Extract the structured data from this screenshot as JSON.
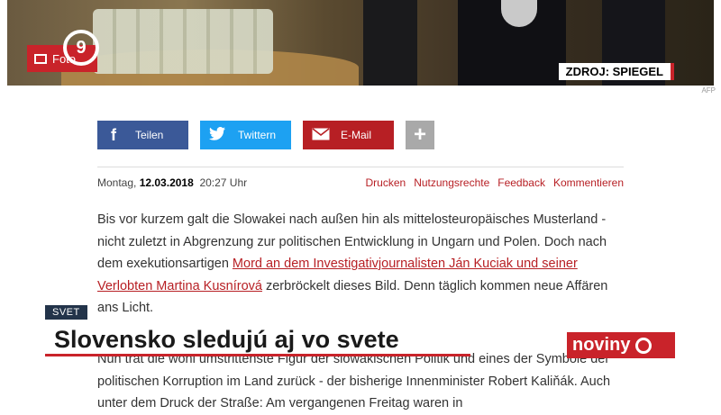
{
  "photo": {
    "badge_label": "Foto",
    "logo_text": "9",
    "source": "ZDROJ: SPIEGEL",
    "credit": "AFP"
  },
  "share": {
    "facebook": "Teilen",
    "twitter": "Twittern",
    "email": "E-Mail",
    "more": "+"
  },
  "meta": {
    "weekday": "Montag,",
    "date": "12.03.2018",
    "time": "20:27 Uhr",
    "links": [
      "Drucken",
      "Nutzungsrechte",
      "Feedback",
      "Kommentieren"
    ]
  },
  "article": {
    "p1_text_a": "Bis vor kurzem galt die Slowakei nach außen hin als mittelosteuropäisches Musterland - nicht zuletzt in Abgrenzung zur politischen Entwicklung in Ungarn und Polen. Doch nach dem exekutionsartigen ",
    "p1_link": "Mord an dem Investigativjournalisten Ján Kuciak und seiner Verlobten Martina Kusnírová",
    "p1_text_b": " zerbröckelt dieses Bild. Denn täglich kommen neue Affären ans Licht.",
    "p2_text_a": "Nun trat die wohl umstrittenste Figur der slowakischen Politik und eines der Symbole der politischen Korruption im Land zurück - der ",
    "p2_link": "bisherige Innenminister Robert Kaliňák",
    "p2_text_b": ". Auch unter dem Druck der Straße: Am vergangenen Freitag waren in"
  },
  "overlay": {
    "category": "SVET",
    "headline": "Slovensko sledujú aj vo svete",
    "brand": "noviny"
  },
  "colors": {
    "accent": "#c9232a",
    "facebook": "#3b5998",
    "twitter": "#1da1f2",
    "link": "#b71f24",
    "category_bg": "#23344a"
  }
}
